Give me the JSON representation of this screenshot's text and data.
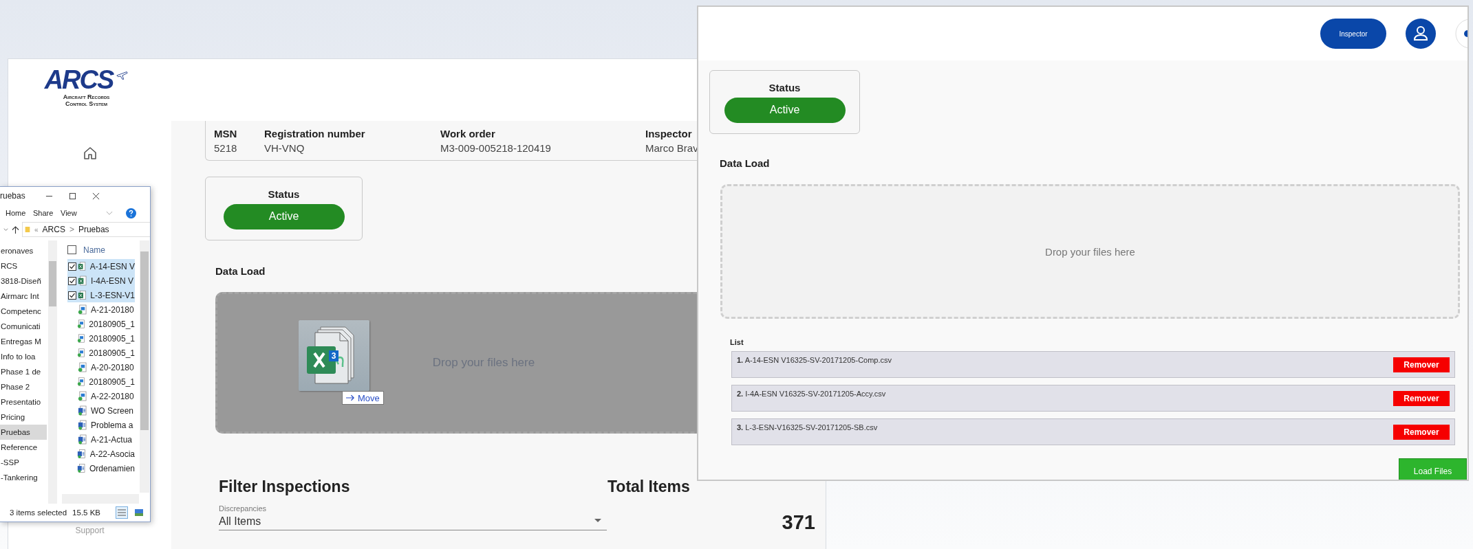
{
  "main_window": {
    "logo": {
      "mark": "ARCS",
      "subtitle": [
        "Aircraft Records",
        "Control System"
      ]
    },
    "sidebar": {
      "support": "Support"
    },
    "aircraft": [
      {
        "label": "MSN",
        "value": "5218"
      },
      {
        "label": "Registration number",
        "value": "VH-VNQ"
      },
      {
        "label": "Work order",
        "value": "M3-009-005218-120419"
      },
      {
        "label": "Inspector",
        "value": "Marco Brav"
      }
    ],
    "status": {
      "label": "Status",
      "value": "Active"
    },
    "data_load": {
      "title": "Data Load",
      "drop_text": "Drop your files here",
      "drag_over": true
    },
    "filter": {
      "title": "Filter Inspections",
      "field_label": "Discrepancies",
      "value": "All Items"
    },
    "total": {
      "title": "Total Items",
      "value": "371"
    }
  },
  "drag_preview": {
    "count": "3",
    "action": "Move"
  },
  "explorer": {
    "title": "ruebas",
    "ribbon_tabs": [
      "Home",
      "Share",
      "View"
    ],
    "path": [
      {
        "text": "«",
        "kind": "more"
      },
      {
        "text": "ARCS",
        "kind": "crumb"
      },
      {
        "text": ">",
        "kind": "separator"
      },
      {
        "text": "Pruebas",
        "kind": "crumb"
      }
    ],
    "all_selected": false,
    "nav_items": [
      {
        "label": "eronaves",
        "selected": false
      },
      {
        "label": "RCS",
        "selected": false
      },
      {
        "label": "3818-Diseñ",
        "selected": false
      },
      {
        "label": "Airmarc Int",
        "selected": false
      },
      {
        "label": "Competenc",
        "selected": false
      },
      {
        "label": "Comunicati",
        "selected": false
      },
      {
        "label": "Entregas M",
        "selected": false
      },
      {
        "label": "Info to loa",
        "selected": false
      },
      {
        "label": "Phase 1 de",
        "selected": false
      },
      {
        "label": "Phase 2",
        "selected": false
      },
      {
        "label": "Presentatio",
        "selected": false
      },
      {
        "label": "Pricing",
        "selected": false
      },
      {
        "label": "Pruebas",
        "selected": true
      },
      {
        "label": "Reference",
        "selected": false
      },
      {
        "label": "-SSP",
        "selected": false
      },
      {
        "label": "-Tankering",
        "selected": false
      }
    ],
    "column": "Name",
    "files": [
      {
        "name": "A-14-ESN V",
        "kind": "sheet",
        "selected": true
      },
      {
        "name": "I-4A-ESN V",
        "kind": "sheet",
        "selected": true
      },
      {
        "name": "L-3-ESN-V1",
        "kind": "sheet",
        "selected": true
      },
      {
        "name": "A-21-20180",
        "kind": "image",
        "selected": false
      },
      {
        "name": "20180905_1",
        "kind": "image",
        "selected": false
      },
      {
        "name": "20180905_1",
        "kind": "image",
        "selected": false
      },
      {
        "name": "20180905_1",
        "kind": "image",
        "selected": false
      },
      {
        "name": "A-20-20180",
        "kind": "image",
        "selected": false
      },
      {
        "name": "20180905_1",
        "kind": "image",
        "selected": false
      },
      {
        "name": "A-22-20180",
        "kind": "image",
        "selected": false
      },
      {
        "name": "WO Screen",
        "kind": "doc",
        "selected": false
      },
      {
        "name": "Problema a",
        "kind": "doc",
        "selected": false
      },
      {
        "name": "A-21-Actua",
        "kind": "doc",
        "selected": false
      },
      {
        "name": "A-22-Asocia",
        "kind": "doc",
        "selected": false
      },
      {
        "name": "Ordenamien",
        "kind": "doc",
        "selected": false
      }
    ],
    "status": [
      "3 items selected",
      "15.5 KB"
    ]
  },
  "upload_panel": {
    "role_button": "Inspector",
    "status": {
      "label": "Status",
      "value": "Active"
    },
    "data_load": {
      "title": "Data Load",
      "drop_text": "Drop your files here",
      "drag_over": false
    },
    "list": {
      "title": "List",
      "items": [
        {
          "index": "1.",
          "name": "A-14-ESN V16325-SV-20171205-Comp.csv",
          "action": "Remover"
        },
        {
          "index": "2.",
          "name": "I-4A-ESN V16325-SV-20171205-Accy.csv",
          "action": "Remover"
        },
        {
          "index": "3.",
          "name": "L-3-ESN-V16325-SV-20171205-SB.csv",
          "action": "Remover"
        }
      ]
    },
    "load_button": "Load Files"
  }
}
